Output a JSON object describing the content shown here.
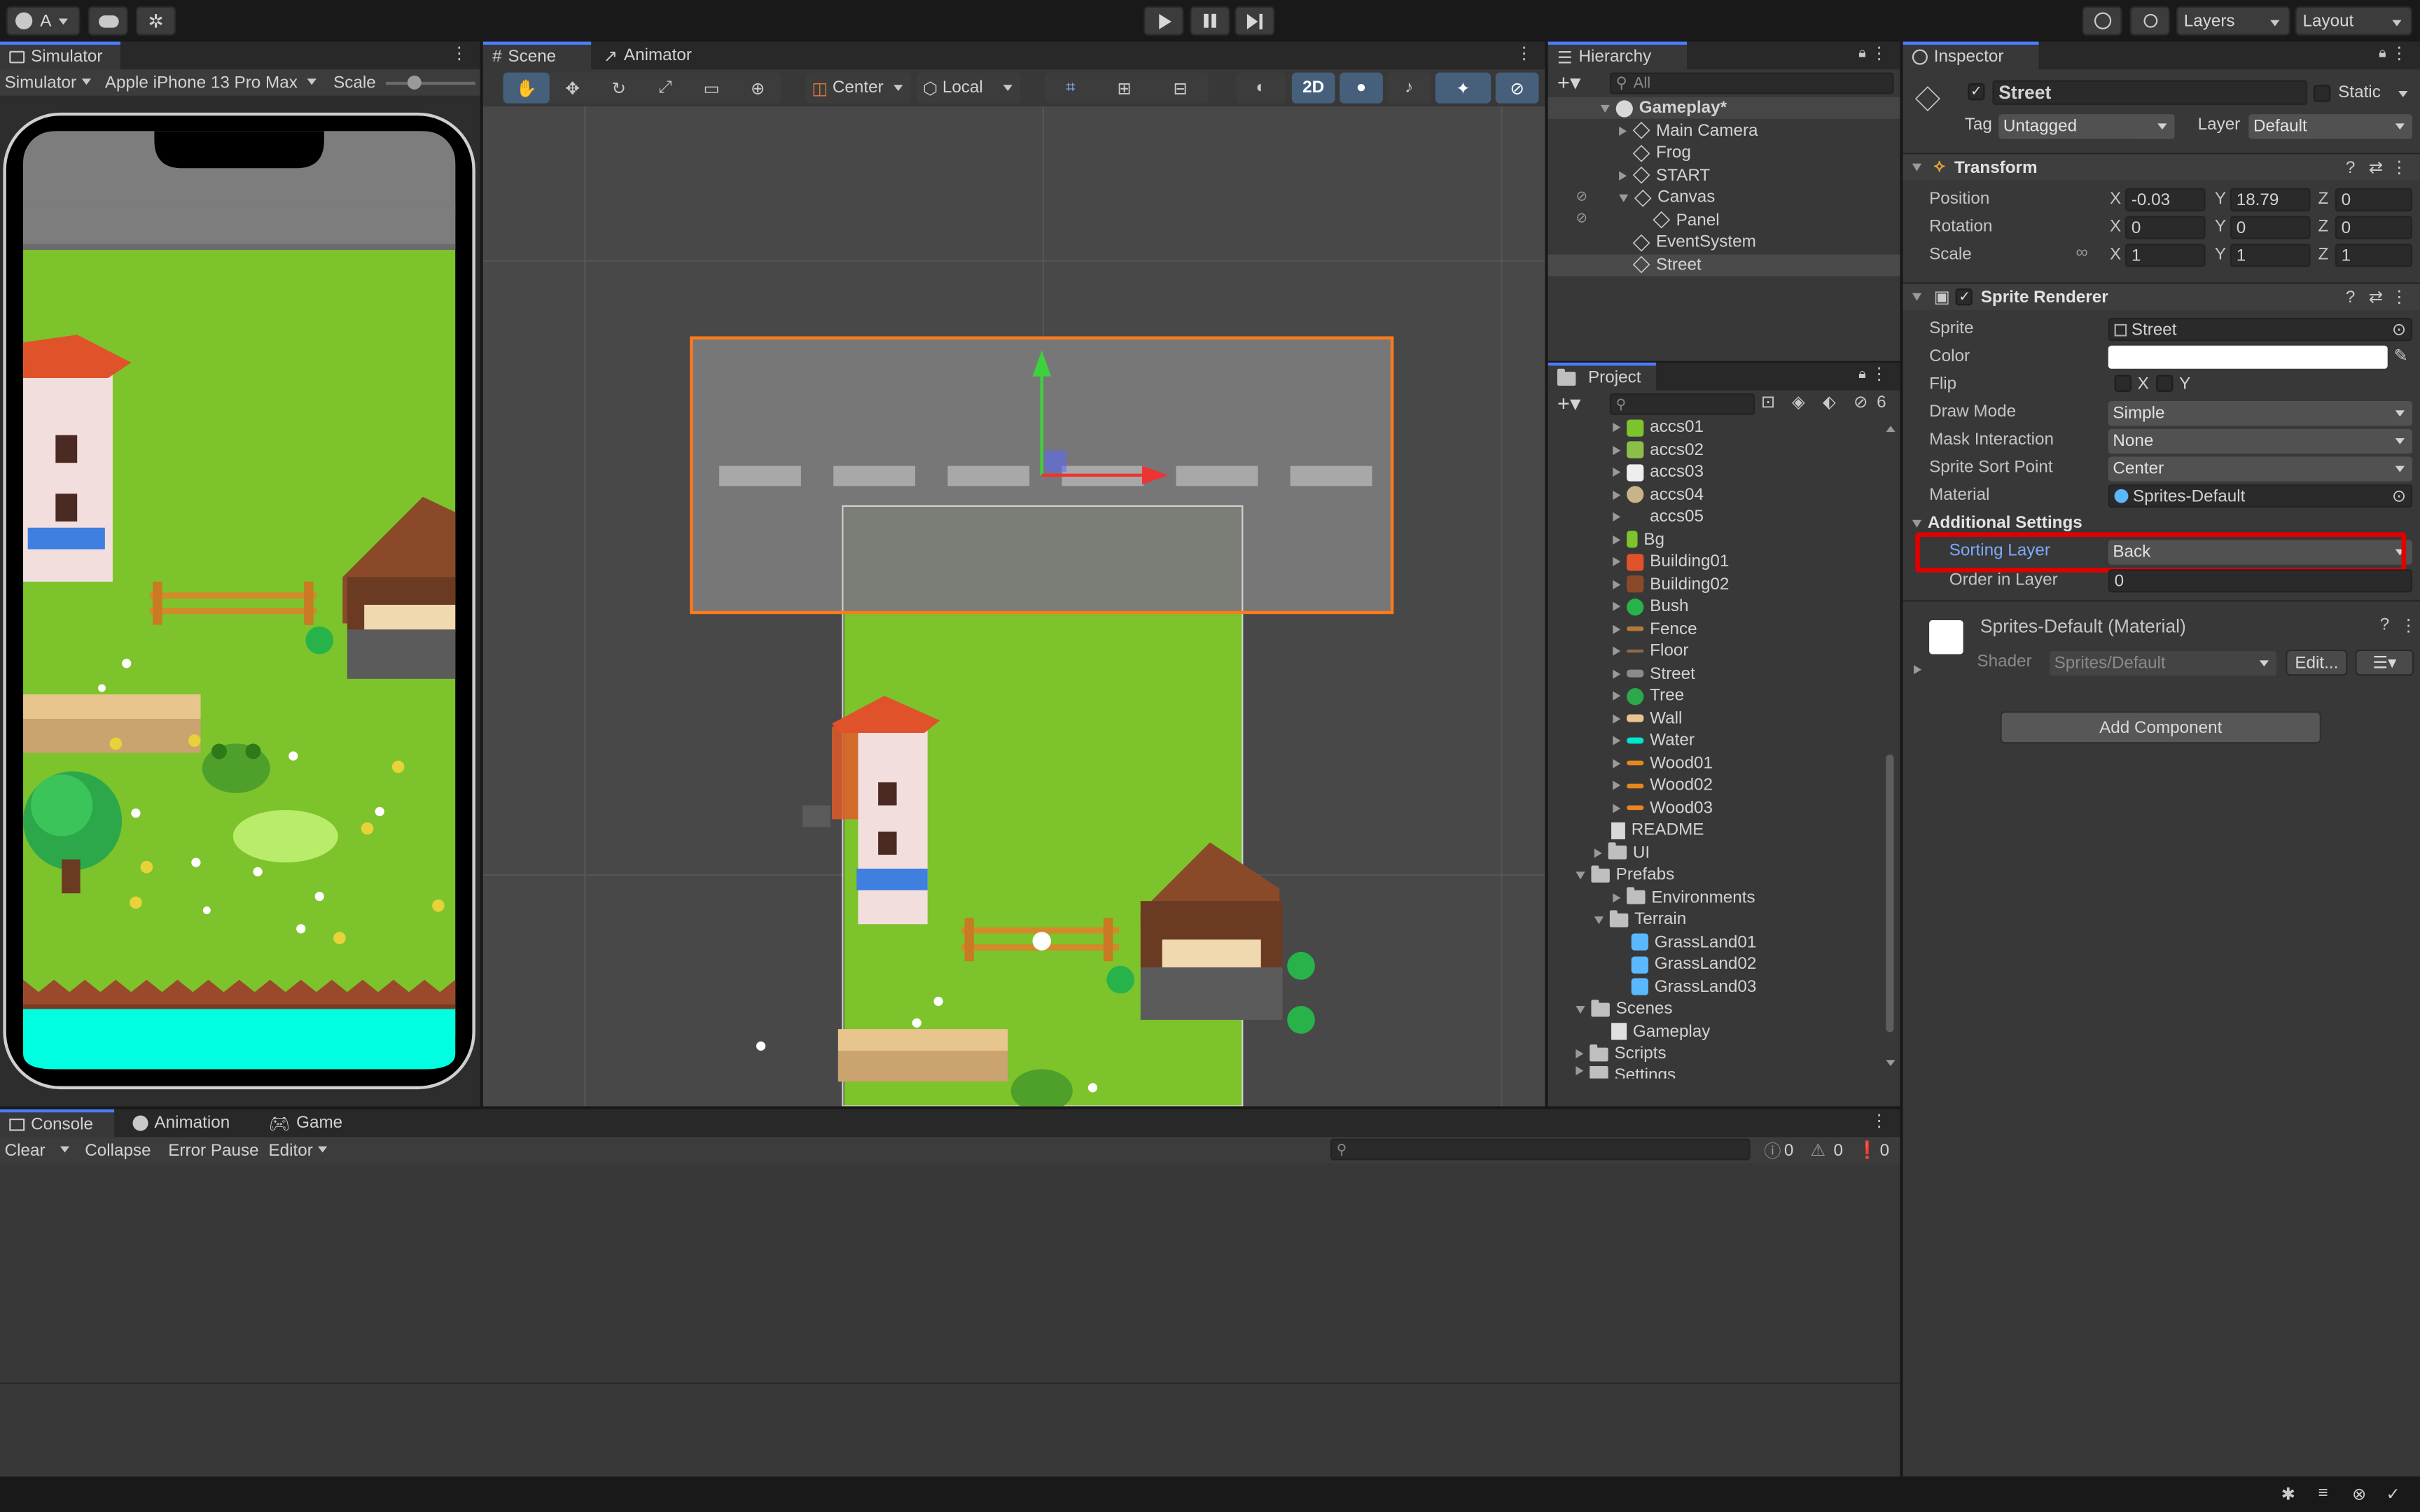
{
  "toolbar": {
    "account_label": "A",
    "play_icon": "play-icon",
    "layers_label": "Layers",
    "layout_label": "Layout"
  },
  "simulator": {
    "tab": "Simulator",
    "mode": "Simulator",
    "device": "Apple iPhone 13 Pro Max",
    "scale_label": "Scale"
  },
  "scene": {
    "tabs": [
      "Scene",
      "Animator"
    ],
    "pivot": "Center",
    "space": "Local",
    "mode_2d": "2D"
  },
  "hierarchy": {
    "tab": "Hierarchy",
    "search_placeholder": "All",
    "root": "Gameplay*",
    "items": [
      "Main Camera",
      "Frog",
      "START",
      "Canvas",
      "Panel",
      "EventSystem",
      "Street"
    ]
  },
  "project": {
    "tab": "Project",
    "count": "6",
    "items": [
      "accs01",
      "accs02",
      "accs03",
      "accs04",
      "accs05",
      "Bg",
      "Building01",
      "Building02",
      "Bush",
      "Fence",
      "Floor",
      "Street",
      "Tree",
      "Wall",
      "Water",
      "Wood01",
      "Wood02",
      "Wood03",
      "README",
      "UI",
      "Prefabs",
      "Environments",
      "Terrain",
      "GrassLand01",
      "GrassLand02",
      "GrassLand03",
      "Scenes",
      "Gameplay",
      "Scripts",
      "Settings"
    ]
  },
  "inspector": {
    "tab": "Inspector",
    "object_name": "Street",
    "static_label": "Static",
    "tag_label": "Tag",
    "tag_value": "Untagged",
    "layer_label": "Layer",
    "layer_value": "Default",
    "transform": {
      "title": "Transform",
      "position_label": "Position",
      "rotation_label": "Rotation",
      "scale_label": "Scale",
      "pos": [
        "-0.03",
        "18.79",
        "0"
      ],
      "rot": [
        "0",
        "0",
        "0"
      ],
      "scale": [
        "1",
        "1",
        "1"
      ]
    },
    "sprite_renderer": {
      "title": "Sprite Renderer",
      "sprite_label": "Sprite",
      "sprite_value": "Street",
      "color_label": "Color",
      "color_value": "#ffffff",
      "flip_label": "Flip",
      "flip_x": "X",
      "flip_y": "Y",
      "draw_mode_label": "Draw Mode",
      "draw_mode": "Simple",
      "mask_label": "Mask Interaction",
      "mask": "None",
      "sort_point_label": "Sprite Sort Point",
      "sort_point": "Center",
      "material_label": "Material",
      "material": "Sprites-Default",
      "additional_label": "Additional Settings",
      "sorting_layer_label": "Sorting Layer",
      "sorting_layer": "Back",
      "order_label": "Order in Layer",
      "order": "0"
    },
    "material": {
      "name": "Sprites-Default (Material)",
      "shader_label": "Shader",
      "shader": "Sprites/Default",
      "edit_label": "Edit..."
    },
    "add_component": "Add Component"
  },
  "console": {
    "tabs": [
      "Console",
      "Animation",
      "Game"
    ],
    "clear": "Clear",
    "collapse": "Collapse",
    "error_pause": "Error Pause",
    "editor": "Editor",
    "counts": [
      "0",
      "0",
      "0"
    ]
  },
  "axes": {
    "x": "X",
    "y": "Y",
    "z": "Z"
  },
  "colors": {
    "accent": "#4c7dff",
    "highlight": "#e00000",
    "selection": "#ff7a1a",
    "grass": "#7dc32b",
    "street": "#7a7a7a",
    "water": "#00ffe0"
  }
}
